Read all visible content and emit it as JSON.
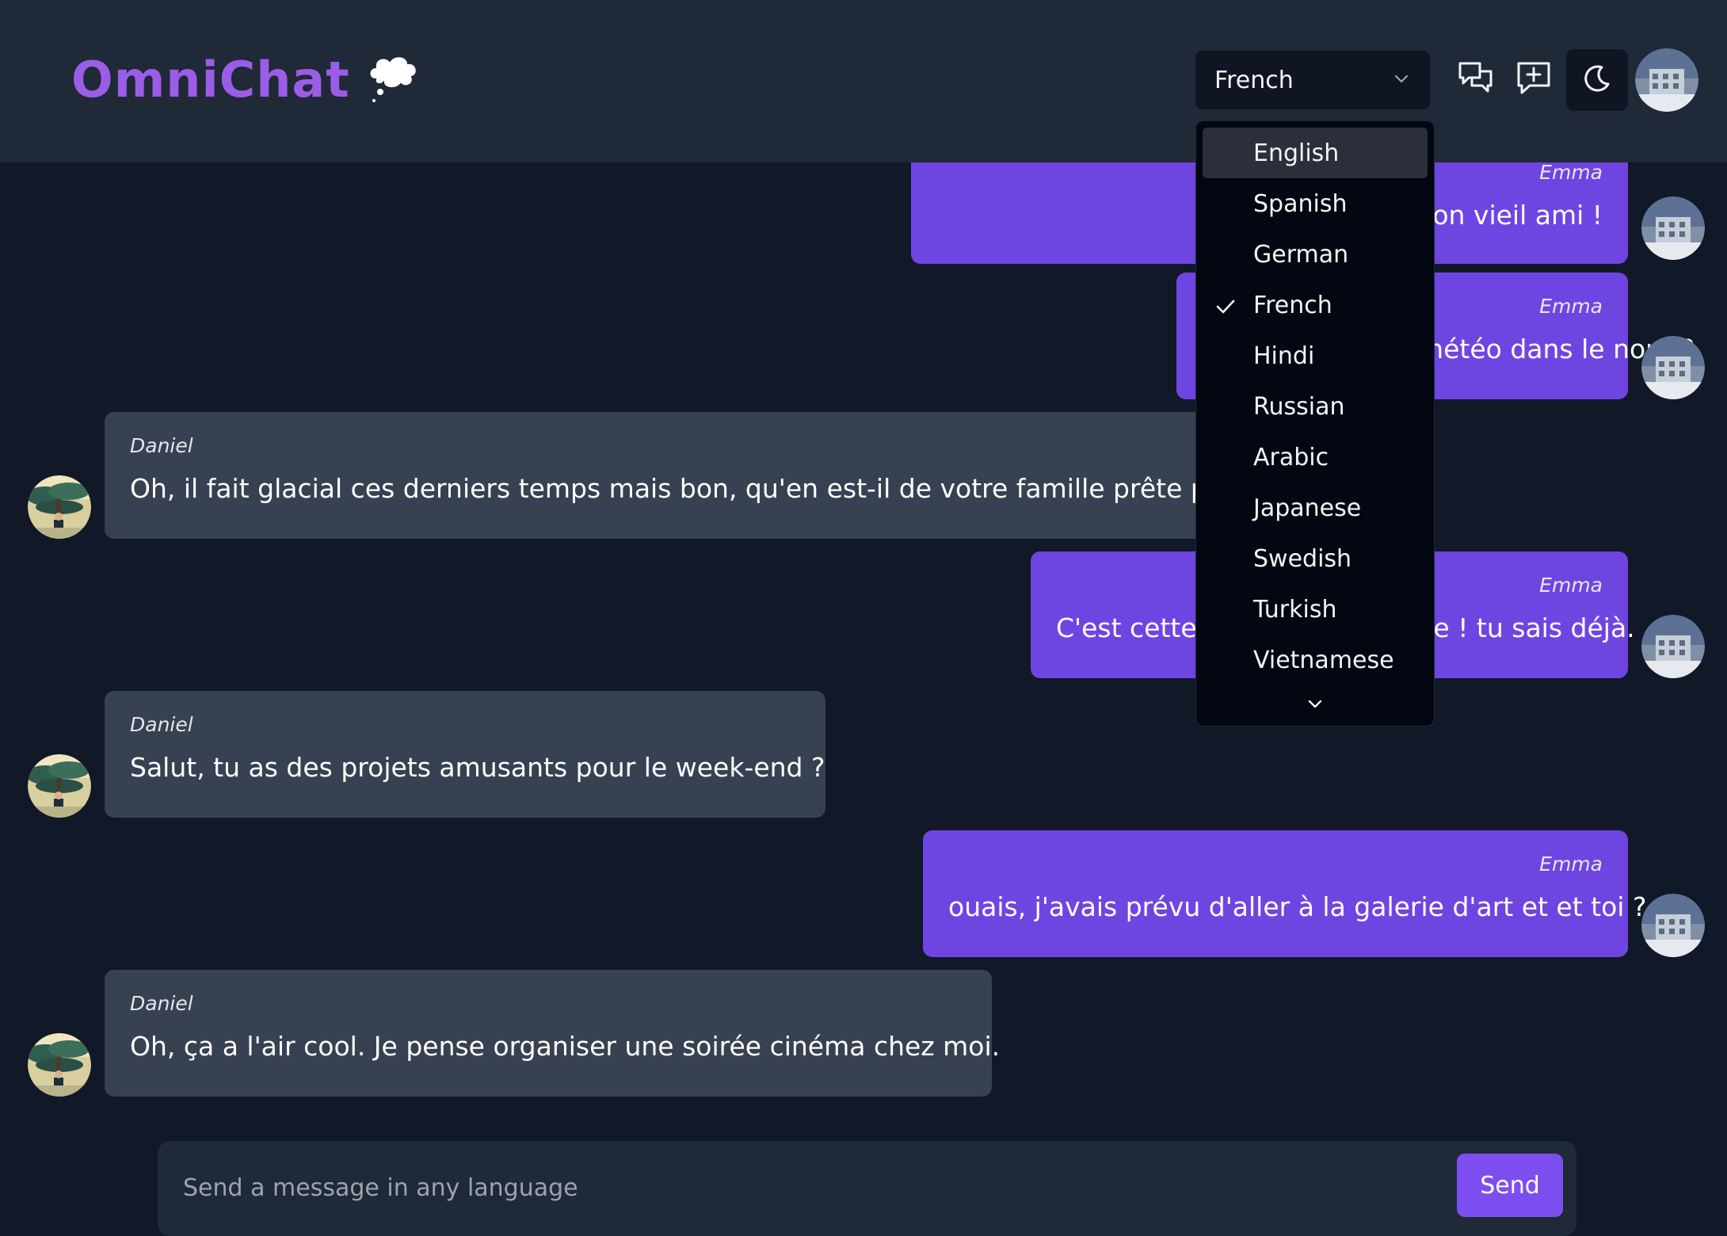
{
  "app": {
    "name": "OmniChat"
  },
  "header": {
    "language_select": {
      "value": "French"
    }
  },
  "language_menu": {
    "options": [
      "English",
      "Spanish",
      "German",
      "French",
      "Hindi",
      "Russian",
      "Arabic",
      "Japanese",
      "Swedish",
      "Turkish",
      "Vietnamese"
    ],
    "selected": "French",
    "highlighted": "English"
  },
  "messages": [
    {
      "sender": "Emma",
      "direction": "outgoing",
      "text": "Bonjour mon vieil ami !"
    },
    {
      "sender": "Emma",
      "direction": "outgoing",
      "text": "Comment est la météo dans le nord ?"
    },
    {
      "sender": "Daniel",
      "direction": "incoming",
      "text": "Oh, il fait glacial ces derniers temps mais bon, qu'en est-il de votre famille prête pour"
    },
    {
      "sender": "Emma",
      "direction": "outgoing",
      "text": "C'est cette période de l'année ! tu sais déjà."
    },
    {
      "sender": "Daniel",
      "direction": "incoming",
      "text": "Salut, tu as des projets amusants pour le week-end ?"
    },
    {
      "sender": "Emma",
      "direction": "outgoing",
      "text": "ouais, j'avais prévu d'aller à la galerie d'art et et toi ?"
    },
    {
      "sender": "Daniel",
      "direction": "incoming",
      "text": "Oh, ça a l'air cool. Je pense organiser une soirée cinéma chez moi."
    }
  ],
  "composer": {
    "placeholder": "Send a message in any language",
    "value": "",
    "send_label": "Send"
  },
  "colors": {
    "background": "#111827",
    "header": "#1f2937",
    "brand": "#9b5de5",
    "outgoing_bubble": "#6f45e2",
    "incoming_bubble": "#374151",
    "send_button": "#7c4ef0",
    "dropdown": "#030712"
  },
  "icons": {
    "brand": "thought-bubble-icon",
    "chats": "chat-bubbles-icon",
    "new_chat": "message-plus-icon",
    "theme": "moon-icon",
    "select": "chevron-down-icon",
    "selected": "check-icon",
    "more": "chevron-down-icon"
  }
}
